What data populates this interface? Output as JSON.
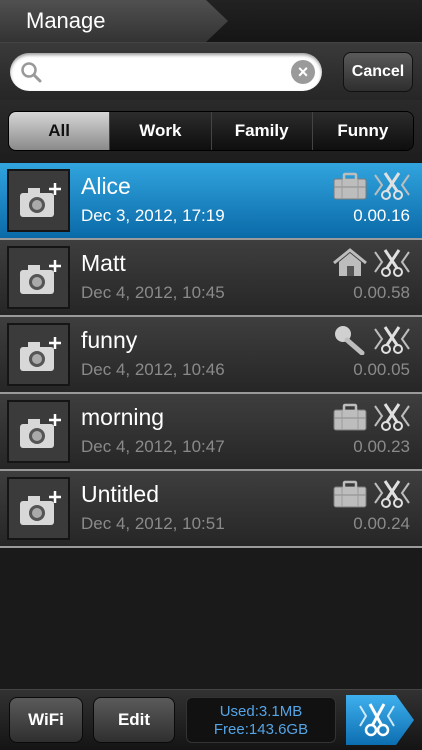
{
  "header": {
    "title": "Manage"
  },
  "search": {
    "value": "",
    "placeholder": "",
    "cancel_label": "Cancel"
  },
  "filters": [
    {
      "label": "All",
      "active": true
    },
    {
      "label": "Work",
      "active": false
    },
    {
      "label": "Family",
      "active": false
    },
    {
      "label": "Funny",
      "active": false
    }
  ],
  "recordings": [
    {
      "name": "Alice",
      "date": "Dec 3, 2012, 17:19",
      "duration": "0.00.16",
      "category": "briefcase-icon",
      "selected": true
    },
    {
      "name": "Matt",
      "date": "Dec 4, 2012, 10:45",
      "duration": "0.00.58",
      "category": "house-icon",
      "selected": false
    },
    {
      "name": "funny",
      "date": "Dec 4, 2012, 10:46",
      "duration": "0.00.05",
      "category": "microphone-icon",
      "selected": false
    },
    {
      "name": "morning",
      "date": "Dec 4, 2012, 10:47",
      "duration": "0.00.23",
      "category": "briefcase-icon",
      "selected": false
    },
    {
      "name": "Untitled",
      "date": "Dec 4, 2012, 10:51",
      "duration": "0.00.24",
      "category": "briefcase-icon",
      "selected": false
    }
  ],
  "toolbar": {
    "wifi_label": "WiFi",
    "edit_label": "Edit",
    "used": "Used:3.1MB",
    "free": "Free:143.6GB"
  },
  "colors": {
    "accent": "#1e8fd0",
    "selected_row": "#1680c2",
    "storage_text": "#55a4e6"
  }
}
